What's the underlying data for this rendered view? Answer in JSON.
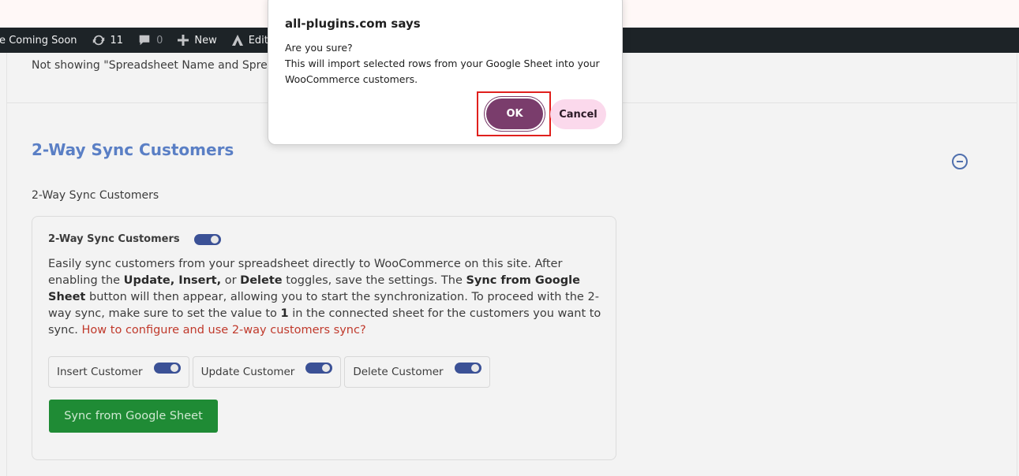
{
  "admin_bar": {
    "coming_soon": "re Coming Soon",
    "updates_count": "11",
    "comments_count": "0",
    "new_label": "New",
    "edit_label": "Edit Live"
  },
  "page": {
    "notice_text": "Not showing \"Spreadsheet Name and Spre",
    "section_title": "2-Way Sync Customers",
    "subsection_label": "2-Way Sync Customers",
    "card": {
      "header_label": "2-Way Sync Customers",
      "desc": {
        "p1": "Easily sync customers from your spreadsheet directly to WooCommerce on this site. After enabling the ",
        "b1": "Update, Insert,",
        "p2": " or ",
        "b2": "Delete",
        "p3": " toggles, save the settings. The ",
        "b3": "Sync from Google Sheet",
        "p4": " button will then appear, allowing you to start the synchronization. To proceed with the 2-way sync, make sure to set the value to ",
        "b4": "1",
        "p5": " in the connected sheet for the customers you want to sync. ",
        "link": "How to configure and use 2-way customers sync?"
      },
      "options": [
        {
          "label": "Insert Customer",
          "enabled": true
        },
        {
          "label": "Update Customer",
          "enabled": true
        },
        {
          "label": "Delete Customer",
          "enabled": true
        }
      ],
      "sync_button_label": "Sync from Google Sheet"
    }
  },
  "dialog": {
    "title": "all-plugins.com says",
    "line1": "Are you sure?",
    "line2": "This will import selected rows from your Google Sheet into your WooCommerce customers.",
    "ok_label": "OK",
    "cancel_label": "Cancel"
  },
  "colors": {
    "section_title": "#5a7fc5",
    "toggle_on": "#3b5196",
    "sync_button": "#1f8b35",
    "ok_button": "#7a3d6c",
    "cancel_button": "#fbd9ec",
    "highlight_box": "#e0201d"
  }
}
